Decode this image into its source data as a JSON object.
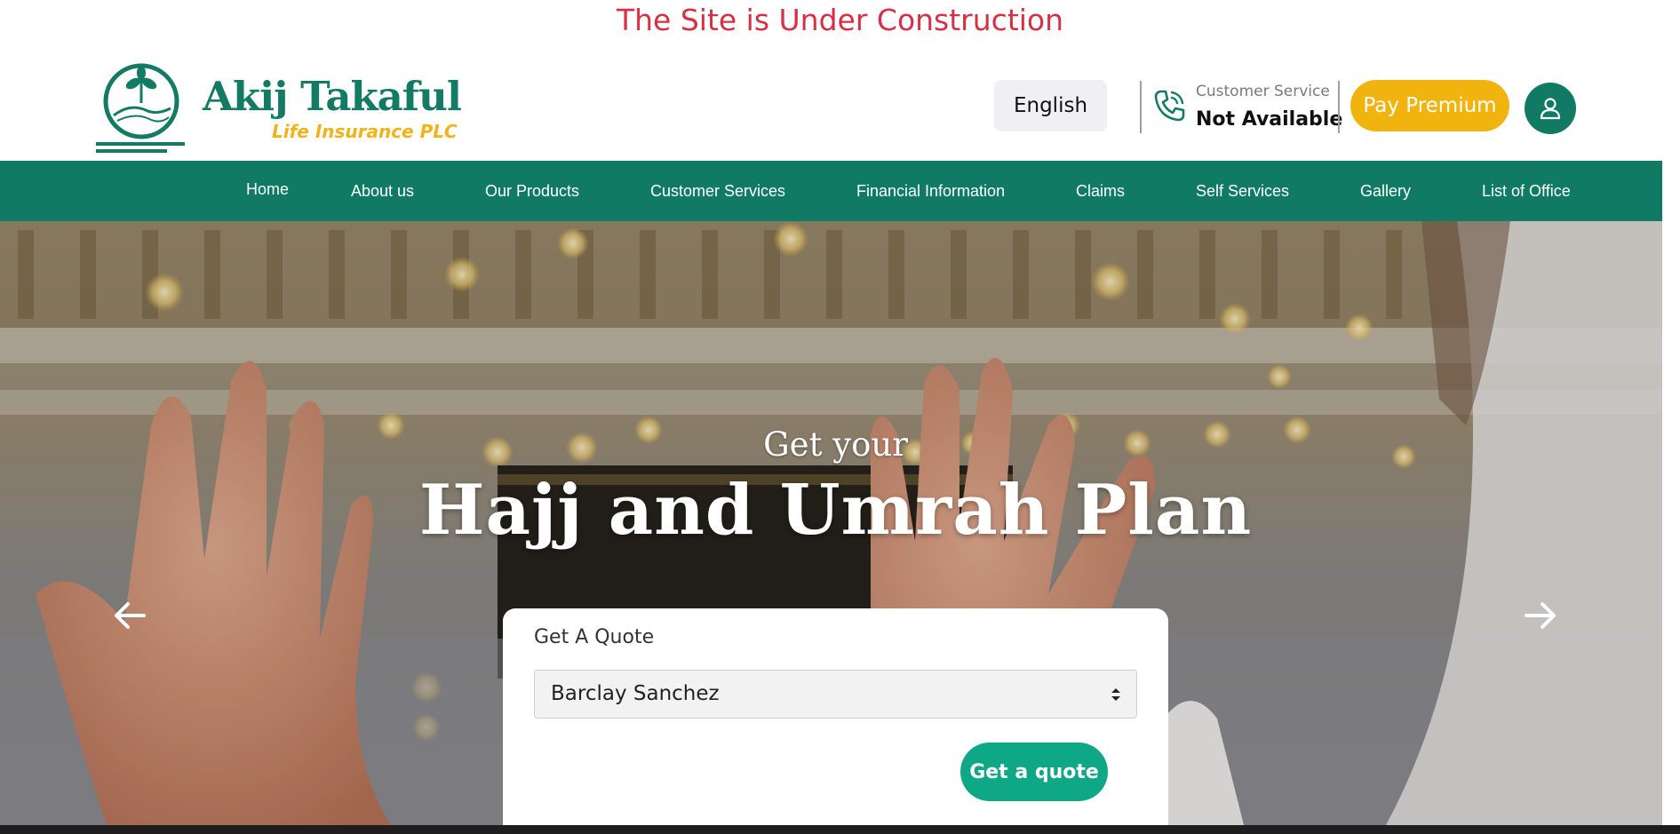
{
  "banner": {
    "text": "The Site is Under Construction"
  },
  "brand": {
    "name": "Akij Takaful",
    "subtitle": "Life Insurance PLC",
    "logo_icon": "akij-takaful-emblem"
  },
  "header": {
    "language_label": "English",
    "customer_service_label": "Customer Service",
    "customer_service_value": "Not Available",
    "pay_label": "Pay Premium",
    "phone_icon": "phone-icon",
    "user_icon": "user-icon"
  },
  "nav": {
    "items": [
      {
        "label": "Home"
      },
      {
        "label": "About us"
      },
      {
        "label": "Our Products"
      },
      {
        "label": "Customer Services"
      },
      {
        "label": "Financial Information"
      },
      {
        "label": "Claims"
      },
      {
        "label": "Self Services"
      },
      {
        "label": "Gallery"
      },
      {
        "label": "List of Office"
      }
    ]
  },
  "hero": {
    "pretitle": "Get your",
    "title": "Hajj and Umrah Plan",
    "prev_icon": "arrow-left-icon",
    "next_icon": "arrow-right-icon"
  },
  "quote": {
    "label": "Get A Quote",
    "selected": "Barclay Sanchez",
    "button_label": "Get a quote"
  },
  "colors": {
    "brand_green": "#107a64",
    "accent_yellow": "#f1b30e",
    "banner_red": "#d63045",
    "quote_button": "#0fa886"
  }
}
